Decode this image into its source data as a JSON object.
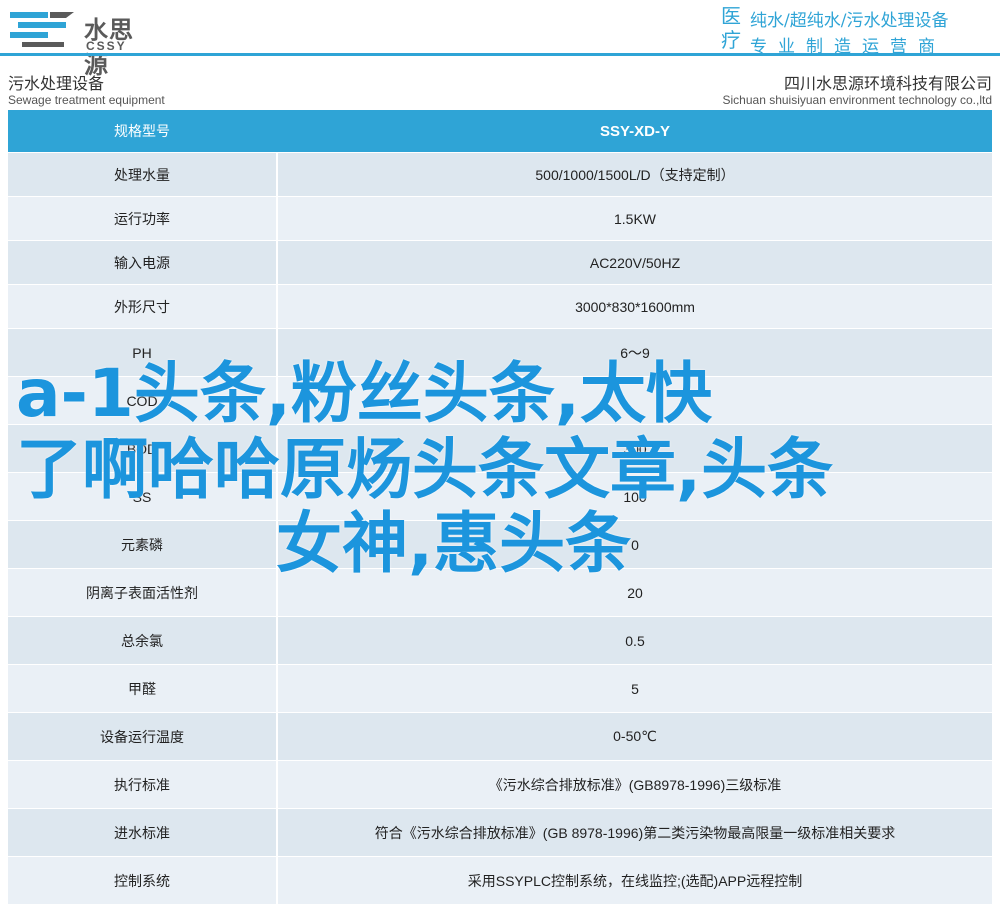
{
  "banner": {
    "logo_cn": "水思源",
    "logo_en": "CSSY",
    "vertical_chars": [
      "医",
      "疗"
    ],
    "line1": "纯水/超纯水/污水处理设备",
    "line2": "专业制造运营商",
    "accent_color": "#2fa4d6"
  },
  "subheader": {
    "left_cn": "污水处理设备",
    "left_en": "Sewage treatment equipment",
    "right_cn": "四川水思源环境科技有限公司",
    "right_en": "Sichuan shuisiyuan environment technology co.,ltd"
  },
  "table": {
    "header": {
      "label": "规格型号",
      "value": "SSY-XD-Y"
    },
    "rows": [
      {
        "label": "处理水量",
        "value": "500/1000/1500L/D（支持定制）"
      },
      {
        "label": "运行功率",
        "value": "1.5KW"
      },
      {
        "label": "输入电源",
        "value": "AC220V/50HZ"
      },
      {
        "label": "外形尺寸",
        "value": "3000*830*1600mm"
      },
      {
        "label": "PH",
        "value": "6～9"
      },
      {
        "label": "COD",
        "value": ""
      },
      {
        "label": "BOD",
        "value": "300"
      },
      {
        "label": "SS",
        "value": "100"
      },
      {
        "label": "元素磷",
        "value": "0"
      },
      {
        "label": "阴离子表面活性剂",
        "value": "20"
      },
      {
        "label": "总余氯",
        "value": "0.5"
      },
      {
        "label": "甲醛",
        "value": "5"
      },
      {
        "label": "设备运行温度",
        "value": "0-50℃"
      },
      {
        "label": "执行标准",
        "value": "《污水综合排放标准》(GB8978-1996)三级标准"
      },
      {
        "label": "进水标准",
        "value": "符合《污水综合排放标准》(GB 8978-1996)第二类污染物最高限量一级标准相关要求"
      },
      {
        "label": "控制系统",
        "value": "采用SSYPLC控制系统，在线监控;(选配)APP远程控制"
      }
    ]
  },
  "overlay": {
    "line1": "a-1头条,粉丝头条,太快",
    "line2": "了啊哈哈原炀头条文章,头条",
    "line3": "女神,惠头条",
    "color": "#1c95dd"
  }
}
